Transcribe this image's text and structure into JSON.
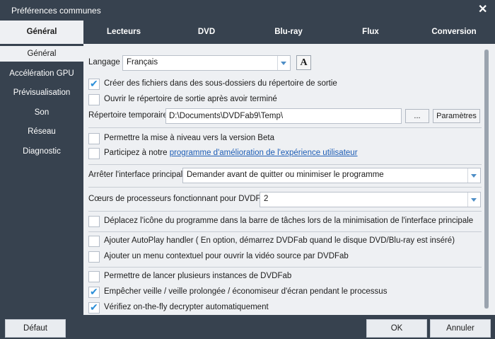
{
  "window": {
    "title": "Préférences communes",
    "close_icon": "close-icon"
  },
  "tabs": [
    {
      "label": "Général",
      "active": true
    },
    {
      "label": "Lecteurs"
    },
    {
      "label": "DVD"
    },
    {
      "label": "Blu-ray"
    },
    {
      "label": "Flux"
    },
    {
      "label": "Conversion"
    }
  ],
  "sidebar": {
    "items": [
      {
        "label": "Général",
        "active": true
      },
      {
        "label": "Accélération GPU"
      },
      {
        "label": "Prévisualisation"
      },
      {
        "label": "Son"
      },
      {
        "label": "Réseau"
      },
      {
        "label": "Diagnostic"
      }
    ]
  },
  "settings": {
    "language_label": "Langage",
    "language_value": "Français",
    "font_button": "A",
    "create_subfolders": {
      "label": "Créer des fichiers dans des sous-dossiers du répertoire de sortie",
      "checked": true
    },
    "open_output_dir": {
      "label": "Ouvrir le répertoire de sortie après avoir terminé",
      "checked": false
    },
    "temp_dir_label": "Répertoire temporaire",
    "temp_dir_value": "D:\\Documents\\DVDFab9\\Temp\\",
    "browse_button": "...",
    "params_button": "Paramètres",
    "beta_upgrade": {
      "label": "Permettre la mise à niveau vers la version Beta",
      "checked": false
    },
    "improvement_program": {
      "label_prefix": "Participez à notre ",
      "link_text": "programme d'amélioration de l'expérience utilisateur",
      "checked": false
    },
    "stop_ui_label": "Arrêter l'interface principale",
    "stop_ui_value": "Demander avant de quitter ou minimiser le programme",
    "cpu_cores_label": "Cœurs de processeurs fonctionnant pour DVDFab",
    "cpu_cores_value": "2",
    "move_tray_icon": {
      "label": "Déplacez l'icône du programme dans la barre de tâches lors de la minimisation de l'interface principale",
      "checked": false
    },
    "autoplay_handler": {
      "label": "Ajouter AutoPlay handler ( En option, démarrez DVDFab quand le disque DVD/Blu-ray est inséré)",
      "checked": false
    },
    "context_menu": {
      "label": "Ajouter un menu contextuel pour ouvrir la vidéo source par DVDFab",
      "checked": false
    },
    "multi_instances": {
      "label": "Permettre de lancer plusieurs instances de DVDFab",
      "checked": false
    },
    "prevent_sleep": {
      "label": "Empêcher veille / veille prolongée / économiseur d'écran pendant le processus",
      "checked": true
    },
    "otf_decrypter": {
      "label": "Vérifiez on-the-fly decrypter automatiquement",
      "checked": true
    }
  },
  "footer": {
    "default_button": "Défaut",
    "ok_button": "OK",
    "cancel_button": "Annuler"
  },
  "colors": {
    "chrome": "#37424f",
    "panel": "#eef0f3",
    "accent": "#2b8ed8",
    "link": "#1d5db5"
  }
}
